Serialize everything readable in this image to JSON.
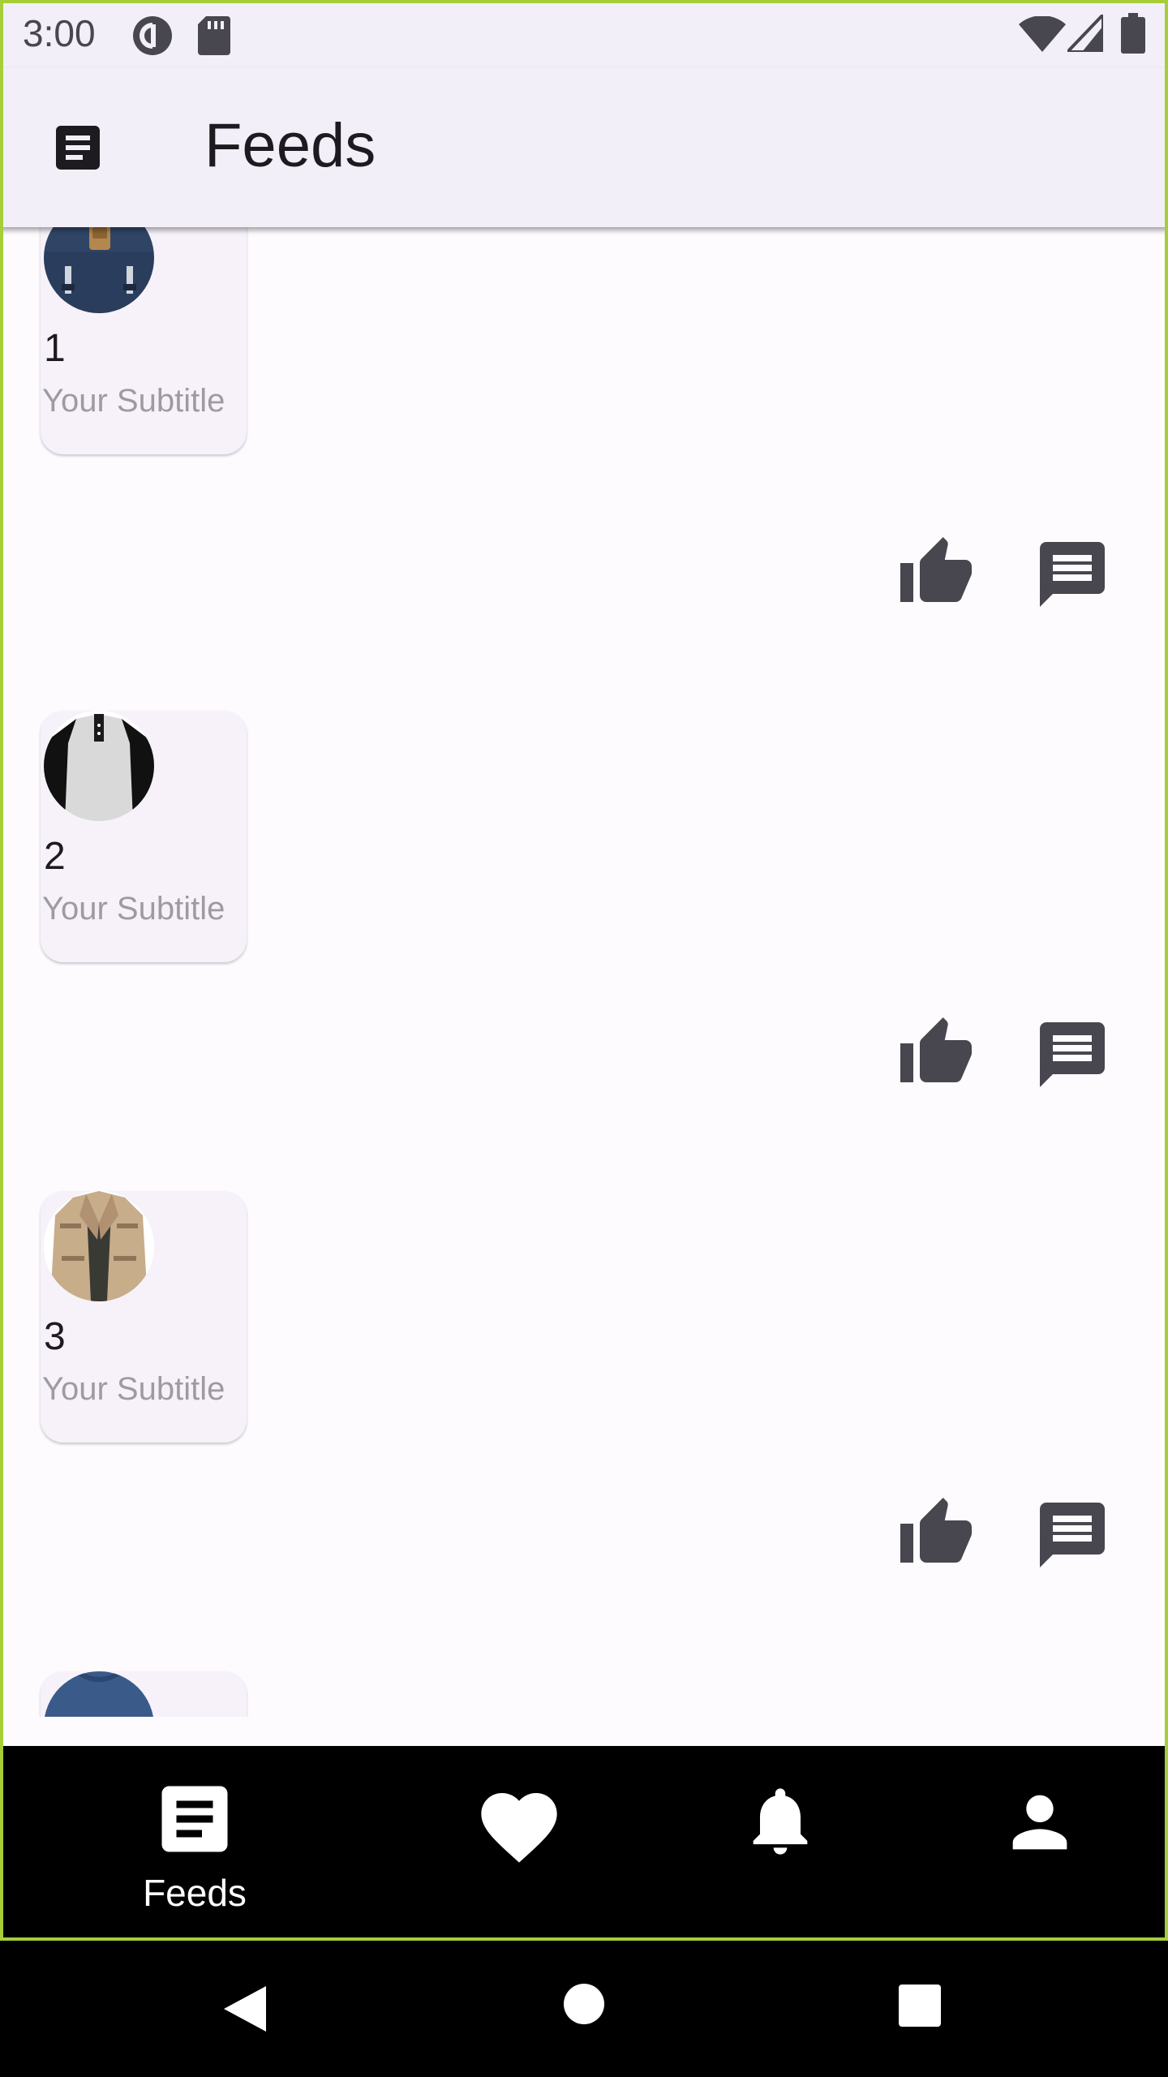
{
  "status_bar": {
    "time": "3:00",
    "icons": [
      "pocket-casts-icon",
      "sd-card-icon",
      "wifi-icon",
      "signal-icon",
      "battery-icon"
    ]
  },
  "app_bar": {
    "icon": "article-icon",
    "title": "Feeds"
  },
  "feed": {
    "items": [
      {
        "title": "1",
        "subtitle": "Your Subtitle",
        "image": "navy-backpack",
        "actions": [
          "thumb-up-icon",
          "comment-icon"
        ]
      },
      {
        "title": "2",
        "subtitle": "Your Subtitle",
        "image": "raglan-henley-shirt",
        "actions": [
          "thumb-up-icon",
          "comment-icon"
        ]
      },
      {
        "title": "3",
        "subtitle": "Your Subtitle",
        "image": "khaki-field-jacket",
        "actions": [
          "thumb-up-icon",
          "comment-icon"
        ]
      },
      {
        "title": "",
        "subtitle": "",
        "image": "blue-longsleeve-shirt",
        "actions": []
      }
    ]
  },
  "bottom_nav": {
    "items": [
      {
        "icon": "article-icon",
        "label": "Feeds",
        "selected": true
      },
      {
        "icon": "heart-icon",
        "label": "",
        "selected": false
      },
      {
        "icon": "bell-icon",
        "label": "",
        "selected": false
      },
      {
        "icon": "person-icon",
        "label": "",
        "selected": false
      }
    ]
  },
  "system_nav": {
    "items": [
      "back-icon",
      "home-icon",
      "recents-icon"
    ]
  },
  "colors": {
    "surface": "#f3eff9",
    "background": "#fefbff",
    "card": "#f7f2fa",
    "icon_dark": "#48464f",
    "on_surface": "#1d1b20",
    "subtitle": "#9e9aa3",
    "frame_accent": "#a6ce39",
    "nav_background": "#000000"
  }
}
